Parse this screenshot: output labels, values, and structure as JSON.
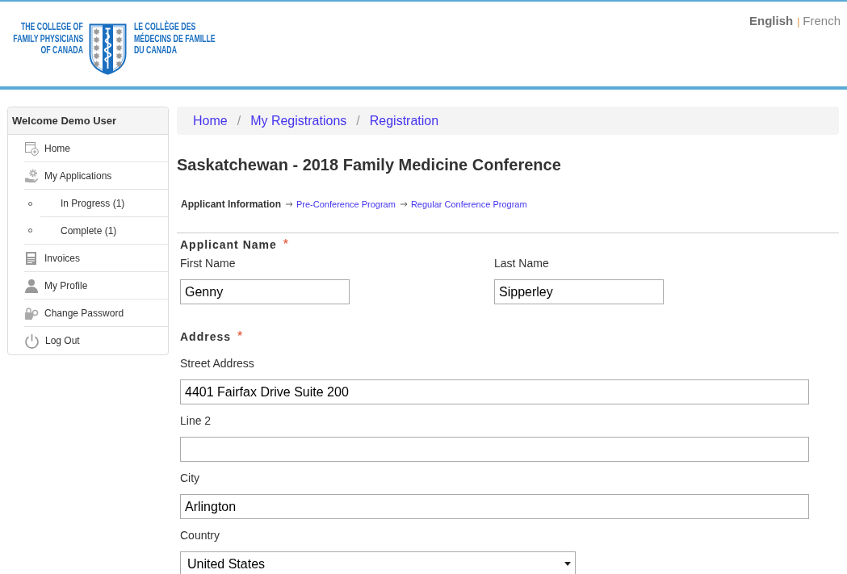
{
  "header": {
    "logo": {
      "english_lines": [
        "THE COLLEGE OF",
        "FAMILY PHYSICIANS",
        "OF CANADA"
      ],
      "french_lines": [
        "LE COLLÈGE DES",
        "MÉDECINS DE FAMILLE",
        "DU CANADA"
      ]
    },
    "languages": [
      {
        "label": "English",
        "selected": true
      },
      {
        "label": "French",
        "selected": false
      }
    ],
    "language_separator": "|"
  },
  "sidebar": {
    "title": "Welcome Demo User",
    "items": [
      {
        "label": "Home"
      },
      {
        "label": "My Applications",
        "children": [
          {
            "label": "In Progress (1)"
          },
          {
            "label": "Complete (1)"
          }
        ]
      },
      {
        "label": "Invoices"
      },
      {
        "label": "My Profile"
      },
      {
        "label": "Change Password"
      },
      {
        "label": "Log Out"
      }
    ]
  },
  "breadcrumb": {
    "items": [
      "Home",
      "My Registrations",
      "Registration"
    ],
    "separators": [
      "/",
      "/"
    ]
  },
  "page_title": "Saskatchewan - 2018 Family Medicine Conference",
  "steps": [
    {
      "label": "Applicant Information",
      "selected": true
    },
    {
      "label": "Pre-Conference Program",
      "selected": false
    },
    {
      "label": "Regular Conference Program",
      "selected": false
    }
  ],
  "sections": [
    {
      "title": "Applicant Name",
      "required_mark": "*",
      "kind": "columns",
      "fields": [
        {
          "label": "First Name",
          "value": "Genny",
          "kind": "text"
        },
        {
          "label": "Last Name",
          "value": "Sipperley",
          "kind": "text"
        }
      ]
    },
    {
      "title": "Address",
      "required_mark": "*",
      "kind": "stacked",
      "fields": [
        {
          "label": "Street Address",
          "value": "4401 Fairfax Drive Suite 200",
          "kind": "text"
        },
        {
          "label": "Line 2",
          "kind": "text"
        },
        {
          "label": "City",
          "value": "Arlington",
          "kind": "text"
        },
        {
          "label": "Country",
          "value": "United States",
          "kind": "select"
        }
      ]
    }
  ]
}
